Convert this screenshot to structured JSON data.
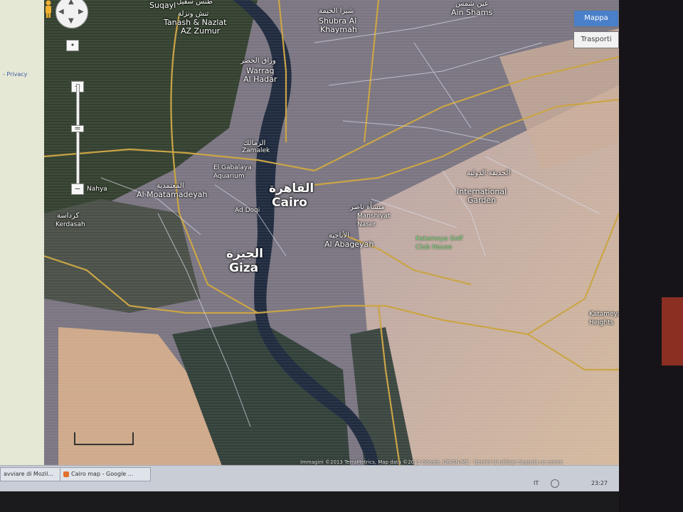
{
  "sidebar": {
    "privacy_link": "- Privacy"
  },
  "map_controls": {
    "map_type_buttons": [
      "Mappa",
      "Trasporti"
    ],
    "zoom_in_label": "+",
    "zoom_out_label": "−",
    "pan_up_glyph": "▲",
    "pan_down_glyph": "▼",
    "pan_left_glyph": "◀",
    "pan_right_glyph": "▶"
  },
  "place_labels": [
    {
      "id": "suqayl",
      "text": "Suqayl",
      "arabic": "طنس سقيل"
    },
    {
      "id": "tanash",
      "text": "Tanash & Nazlat",
      "arabic": "تنش ونزلة"
    },
    {
      "id": "az-zumur",
      "text": "AZ Zumur"
    },
    {
      "id": "shubra",
      "text": "Shubra Al",
      "arabic": "شبرا الخيمة"
    },
    {
      "id": "khaymah",
      "text": "Khaymah"
    },
    {
      "id": "ain-shams",
      "text": "Ain Shams",
      "arabic": "عين شمس"
    },
    {
      "id": "warraq",
      "text": "Warraq",
      "arabic": "وراق الحضر"
    },
    {
      "id": "al-hadar",
      "text": "Al Hadar"
    },
    {
      "id": "zamalek",
      "text": "Zamalek",
      "arabic": "الزمالك"
    },
    {
      "id": "aquarium",
      "text": "El Gabalaya Aquarium"
    },
    {
      "id": "cairo",
      "text": "Cairo",
      "arabic": "القاهرة"
    },
    {
      "id": "ad-doqi",
      "text": "Ad Doqi"
    },
    {
      "id": "moatamadeyah",
      "text": "Al Moatamadeyah",
      "arabic": "المعتمدية"
    },
    {
      "id": "nahya",
      "text": "Nahya"
    },
    {
      "id": "kerdasah",
      "text": "Kerdasah",
      "arabic": "كرداسة"
    },
    {
      "id": "giza",
      "text": "Giza",
      "arabic": "الجيزة"
    },
    {
      "id": "manshiyat",
      "text": "Manshiyat Naser",
      "arabic": "منشأة ناصر"
    },
    {
      "id": "al-abageyah",
      "text": "Al Abageyah",
      "arabic": "الأباجية"
    },
    {
      "id": "intl-garden",
      "text": "International Garden",
      "arabic": "الحديقة الدولية"
    },
    {
      "id": "golf",
      "text": "Katameya Golf Club House",
      "green": true
    },
    {
      "id": "katameya",
      "text": "Katameya Heights"
    }
  ],
  "copyright": "Immagini ©2013 TerraMetrics, Map data ©2013 Google, ORION-ME - Termini di utilizzo  Segnala un errore",
  "taskbar": {
    "tasks": [
      {
        "label": "avviare di Mozil..."
      },
      {
        "label": "Cairo map - Google ..."
      }
    ],
    "lang": "IT",
    "clock": "23:27"
  },
  "colors": {
    "river": "#1f2a3e",
    "road_major": "#c9a241",
    "road_minor": "#d8dce8",
    "urban": "#7c7682",
    "desert": "#c8a88c",
    "vegetation": "#2f3a30",
    "map_type_active": "#4a7fc9"
  }
}
